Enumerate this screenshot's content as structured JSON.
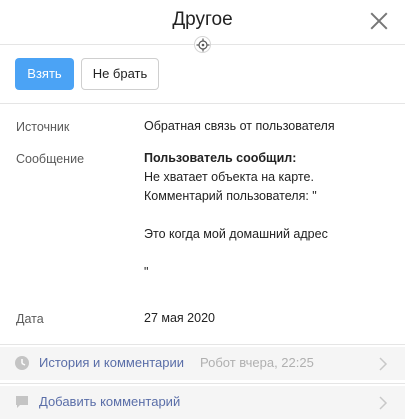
{
  "header": {
    "title": "Другое"
  },
  "actions": {
    "take_label": "Взять",
    "skip_label": "Не брать"
  },
  "fields": {
    "source": {
      "label": "Источник",
      "value": "Обратная связь от пользователя"
    },
    "message": {
      "label": "Сообщение",
      "heading": "Пользователь сообщил:",
      "line1": "Не хватает объекта на карте.",
      "line2": "Комментарий пользователя: \"",
      "line3": "Это когда мой домашний адрес",
      "line4": "\""
    },
    "date": {
      "label": "Дата",
      "value": "27 мая 2020"
    }
  },
  "history": {
    "label": "История и комментарии",
    "meta": "Робот вчера, 22:25",
    "icon": "clock-icon"
  },
  "comment": {
    "label": "Добавить комментарий",
    "icon": "chat-bubble-icon"
  },
  "colors": {
    "primary": "#4ba3f5",
    "link": "#5a6ea8",
    "muted": "#b0b0b0",
    "bar": "#f5f5f5"
  }
}
